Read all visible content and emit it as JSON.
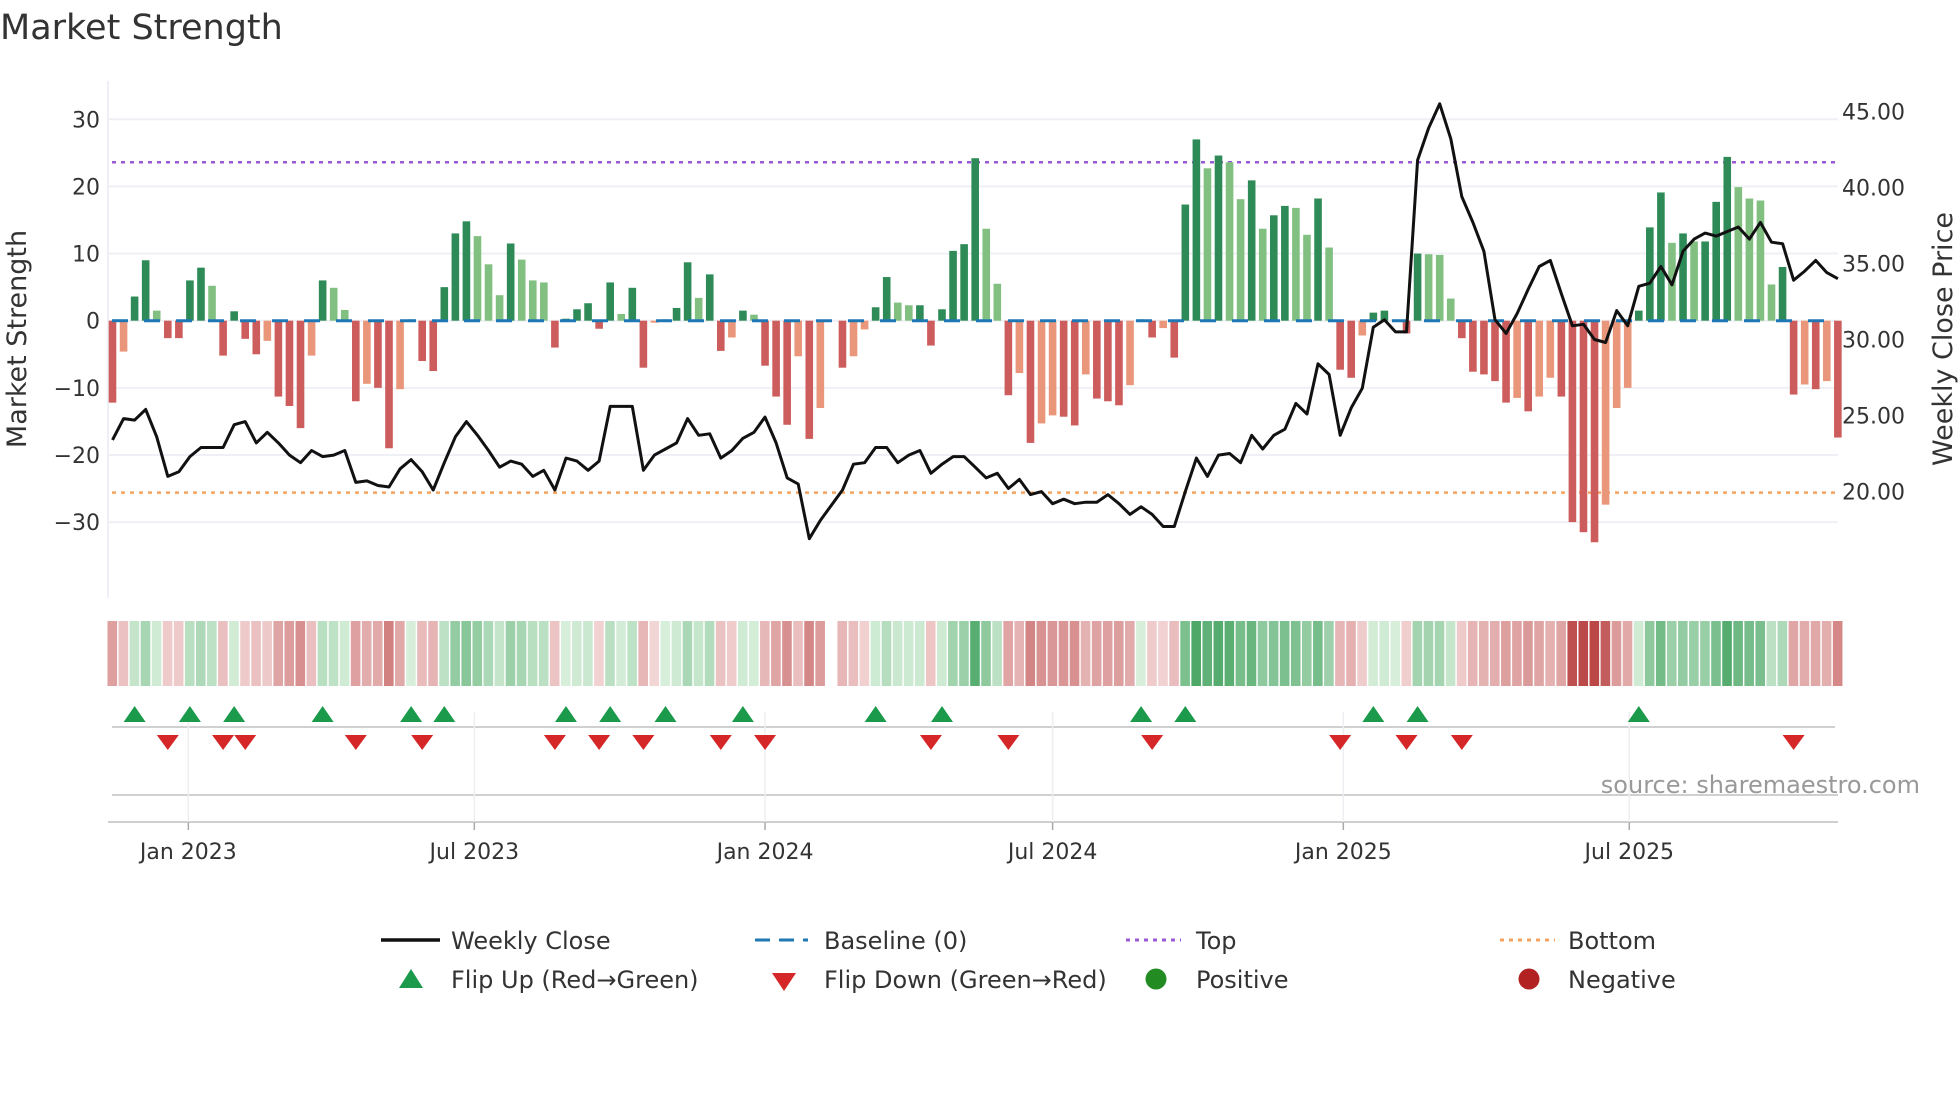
{
  "title": "Market Strength",
  "source": "source: sharemaestro.com",
  "colors": {
    "price_line": "#111111",
    "baseline": "#1f77b4",
    "top": "#9b59d6",
    "bottom": "#f4a460",
    "bar_pos_strong": "#2e8b57",
    "bar_pos_weak": "#82c082",
    "bar_neg_strong": "#cd5c5c",
    "bar_neg_weak": "#e9967a",
    "flip_up": "#1a9a4a",
    "flip_down": "#d62728",
    "positive": "#228b22",
    "negative": "#b22222"
  },
  "chart_data": {
    "type": "bar+line",
    "title": "Market Strength",
    "ylabel": "Market Strength",
    "y2label": "Weekly Close Price",
    "ylim": [
      -41.3,
      35.7
    ],
    "y2lim": [
      13.0,
      47.0
    ],
    "left_ticks": [
      {
        "v": 30,
        "label": "30"
      },
      {
        "v": 20,
        "label": "20"
      },
      {
        "v": 10,
        "label": "10"
      },
      {
        "v": 0,
        "label": "0"
      },
      {
        "v": -10,
        "label": "−10"
      },
      {
        "v": -20,
        "label": "−20"
      },
      {
        "v": -30,
        "label": "−30"
      }
    ],
    "right_ticks": [
      {
        "v": 45,
        "label": "45.00"
      },
      {
        "v": 40,
        "label": "40.00"
      },
      {
        "v": 35,
        "label": "35.00"
      },
      {
        "v": 30,
        "label": "30.00"
      },
      {
        "v": 25,
        "label": "25.00"
      },
      {
        "v": 20,
        "label": "20.00"
      }
    ],
    "x_ticks": [
      {
        "date": "2023-01-01",
        "label": "Jan 2023"
      },
      {
        "date": "2023-07-01",
        "label": "Jul 2023"
      },
      {
        "date": "2024-01-01",
        "label": "Jan 2024"
      },
      {
        "date": "2024-07-01",
        "label": "Jul 2024"
      },
      {
        "date": "2025-01-01",
        "label": "Jan 2025"
      },
      {
        "date": "2025-07-01",
        "label": "Jul 2025"
      }
    ],
    "start_date": "2022-11-14",
    "frequency": "weekly",
    "top_level": 23.6,
    "bottom_level": -25.6,
    "baseline": 0,
    "strength": [
      -12.2,
      -4.6,
      3.6,
      9,
      1.5,
      -2.6,
      -2.6,
      6,
      7.9,
      5.2,
      -5.2,
      1.4,
      -2.7,
      -5,
      -3,
      -11.3,
      -12.7,
      -16,
      -5.2,
      6,
      4.9,
      1.6,
      -12,
      -9.4,
      -10,
      -19,
      -10.2,
      0.2,
      -6,
      -7.5,
      5,
      13,
      14.8,
      12.6,
      8.4,
      3.8,
      11.5,
      9.1,
      6,
      5.7,
      -4,
      0.3,
      1.7,
      2.6,
      -1.2,
      5.7,
      1,
      4.9,
      -7,
      -0.3,
      0.2,
      1.9,
      8.7,
      3.4,
      6.9,
      -4.5,
      -2.5,
      1.5,
      0.9,
      -6.7,
      -11.3,
      -15.5,
      -5.3,
      -17.6,
      -13,
      null,
      -7,
      -5.3,
      -1.3,
      2,
      6.5,
      2.7,
      2.3,
      2.3,
      -3.7,
      1.7,
      10.4,
      11.4,
      24.2,
      13.7,
      5.5,
      -11.1,
      -7.8,
      -18.2,
      -15.3,
      -14.1,
      -14.3,
      -15.6,
      -8,
      -11.6,
      -12,
      -12.6,
      -9.6,
      0.2,
      -2.5,
      -1.1,
      -5.5,
      17.3,
      27,
      22.7,
      24.6,
      23.6,
      18.1,
      20.9,
      13.7,
      15.7,
      17.1,
      16.8,
      12.8,
      18.2,
      10.9,
      -7.3,
      -8.5,
      -2.2,
      1.2,
      1.5,
      0.2,
      -1.9,
      10,
      9.9,
      9.8,
      3.3,
      -2.6,
      -7.6,
      -8,
      -9,
      -12.2,
      -11.5,
      -13.5,
      -11.3,
      -8.5,
      -11.3,
      -30,
      -31.5,
      -33,
      -27.4,
      -13,
      -10,
      1.5,
      13.9,
      19.1,
      11.6,
      13,
      11.8,
      11.8,
      17.7,
      24.4,
      19.9,
      18.2,
      17.9,
      5.4,
      8,
      -11,
      -9.5,
      -10.2,
      -9,
      -17.4
    ],
    "weekly_close": [
      23.4,
      24.8,
      24.7,
      25.4,
      23.6,
      21.0,
      21.3,
      22.3,
      22.9,
      22.9,
      22.9,
      24.4,
      24.6,
      23.2,
      23.9,
      23.2,
      22.4,
      21.9,
      22.7,
      22.3,
      22.4,
      22.7,
      20.6,
      20.7,
      20.4,
      20.3,
      21.5,
      22.1,
      21.3,
      20.1,
      21.9,
      23.6,
      24.6,
      23.7,
      22.7,
      21.6,
      22.0,
      21.8,
      21.0,
      21.4,
      20.1,
      22.2,
      22.0,
      21.4,
      22.0,
      25.6,
      25.6,
      25.6,
      21.4,
      22.4,
      22.8,
      23.2,
      24.8,
      23.7,
      23.8,
      22.2,
      22.7,
      23.5,
      23.9,
      24.9,
      23.2,
      20.9,
      20.5,
      16.9,
      18.1,
      19.1,
      20.1,
      21.8,
      21.9,
      22.9,
      22.9,
      21.9,
      22.4,
      22.7,
      21.2,
      21.8,
      22.3,
      22.3,
      21.6,
      20.9,
      21.2,
      20.2,
      20.8,
      19.8,
      20.0,
      19.2,
      19.5,
      19.2,
      19.3,
      19.3,
      19.8,
      19.2,
      18.5,
      19.0,
      18.5,
      17.7,
      17.7,
      20.0,
      22.2,
      21.0,
      22.4,
      22.5,
      21.9,
      23.7,
      22.8,
      23.7,
      24.1,
      25.8,
      25.1,
      28.4,
      27.7,
      23.7,
      25.5,
      26.8,
      30.8,
      31.3,
      30.5,
      30.5,
      41.8,
      43.9,
      45.5,
      43.2,
      39.4,
      37.7,
      35.8,
      31.3,
      30.4,
      31.7,
      33.3,
      34.8,
      35.2,
      33.0,
      30.9,
      31.0,
      30.0,
      29.8,
      31.9,
      30.9,
      33.5,
      33.7,
      34.8,
      33.6,
      35.8,
      36.6,
      37.0,
      36.8,
      37.1,
      37.4,
      36.6,
      37.7,
      36.4,
      36.3,
      33.9,
      34.5,
      35.2,
      34.4,
      34.0
    ],
    "flip_up_dates": [
      "2022-11-28",
      "2023-01-02",
      "2023-01-30",
      "2023-03-27",
      "2023-05-22",
      "2023-06-12",
      "2023-08-28",
      "2023-09-25",
      "2023-10-30",
      "2023-12-18",
      "2024-03-11",
      "2024-04-22",
      "2024-08-26",
      "2024-09-23",
      "2025-01-20",
      "2025-02-17",
      "2025-07-07"
    ],
    "flip_down_dates": [
      "2022-12-19",
      "2023-01-23",
      "2023-02-06",
      "2023-04-17",
      "2023-05-29",
      "2023-08-21",
      "2023-09-18",
      "2023-10-16",
      "2023-12-04",
      "2024-01-01",
      "2024-04-15",
      "2024-06-03",
      "2024-09-02",
      "2024-12-30",
      "2025-02-10",
      "2025-03-17",
      "2025-10-13"
    ],
    "legend": {
      "placement": "bottom",
      "items": [
        {
          "key": "weekly_close",
          "label": "Weekly Close"
        },
        {
          "key": "baseline",
          "label": "Baseline (0)"
        },
        {
          "key": "top",
          "label": "Top"
        },
        {
          "key": "bottom",
          "label": "Bottom"
        },
        {
          "key": "flip_up",
          "label": "Flip Up (Red→Green)"
        },
        {
          "key": "flip_down",
          "label": "Flip Down (Green→Red)"
        },
        {
          "key": "positive",
          "label": "Positive"
        },
        {
          "key": "negative",
          "label": "Negative"
        }
      ]
    }
  }
}
